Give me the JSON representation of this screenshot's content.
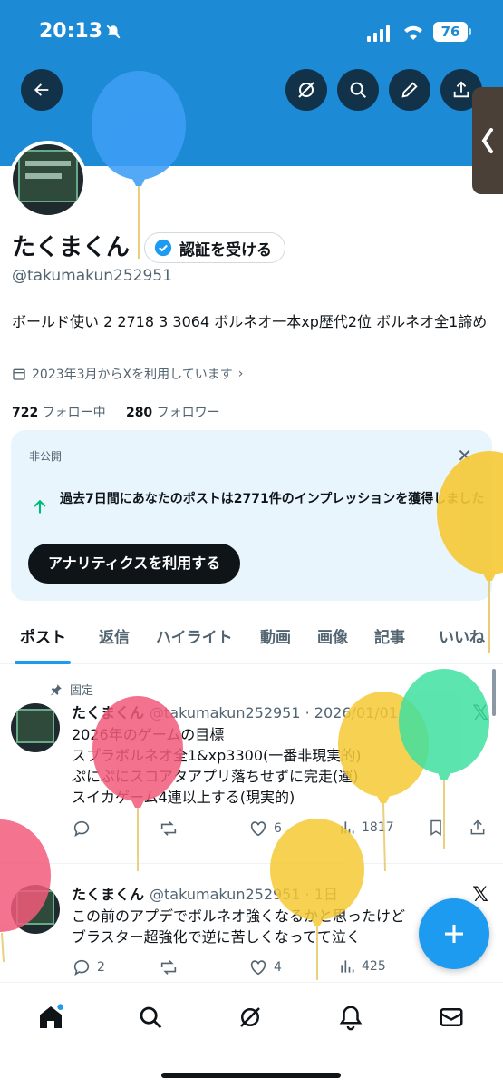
{
  "status_bar": {
    "time": "20:13",
    "battery": "76"
  },
  "profile": {
    "name": "たくまくん",
    "verify_label": "認証を受ける",
    "handle": "@takumakun252951",
    "bio": "ボールド使い 2 2718 3 3064 ボルネオ一本xp歴代2位 ボルネオ全1諦め",
    "joined": "2023年3月からXを利用しています",
    "following_count": "722",
    "following_label": "フォロー中",
    "followers_count": "280",
    "followers_label": "フォロワー"
  },
  "analytics_card": {
    "tag": "非公開",
    "message": "過去7日間にあなたのポストは2771件のインプレッションを獲得しました",
    "cta": "アナリティクスを利用する"
  },
  "tabs": [
    "ポスト",
    "返信",
    "ハイライト",
    "動画",
    "画像",
    "記事",
    "いいね"
  ],
  "posts": [
    {
      "pinned_label": "固定",
      "name": "たくまくん",
      "meta": "@takumakun252951 · 2026/01/01",
      "lines": [
        "2026年のゲームの目標",
        "スプラボルネオ全1&xp3300(一番非現実的)",
        "ぷにぷにスコアタアプリ落ちせずに完走(運)",
        "スイカゲーム4連以上する(現実的)"
      ],
      "likes": "6",
      "views": "1817"
    },
    {
      "name": "たくまくん",
      "meta": "@takumakun252951 · 1日",
      "lines": [
        "この前のアプデでボルネオ強くなるかと思ったけど",
        "ブラスター超強化で逆に苦しくなってて泣く"
      ],
      "replies": "2",
      "likes": "4",
      "views": "425"
    }
  ],
  "colors": {
    "banner": "#1d8ad6",
    "accent": "#1d9bf0",
    "card_bg": "#e8f5fd"
  }
}
